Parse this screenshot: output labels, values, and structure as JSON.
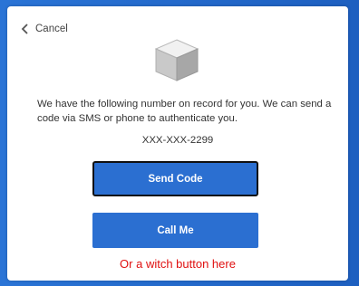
{
  "header": {
    "cancel_label": "Cancel",
    "cancel_icon": "chevron-left-icon"
  },
  "illustration": {
    "icon": "cube-icon"
  },
  "body": {
    "message": "We have the following number on record for you. We can send a code via SMS or phone to authenticate you.",
    "phone_number": "XXX-XXX-2299"
  },
  "actions": {
    "send_code_label": "Send Code",
    "call_me_label": "Call Me"
  },
  "annotation": {
    "text": "Or a witch button here"
  },
  "colors": {
    "backdrop": "#1f67c9",
    "button": "#2b6fd1",
    "annotation": "#e01010"
  }
}
